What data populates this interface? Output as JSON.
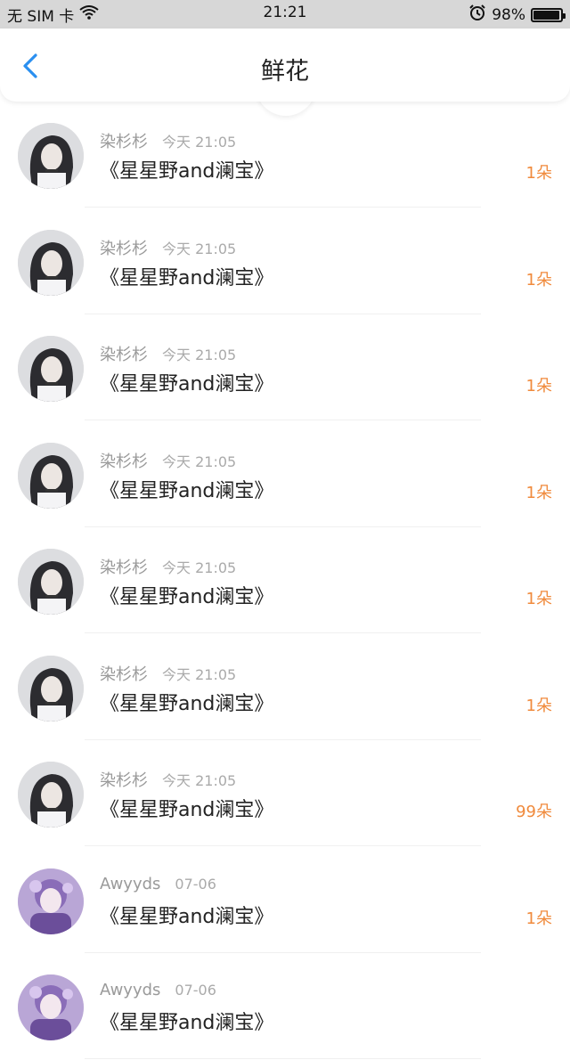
{
  "status_bar": {
    "carrier": "无 SIM 卡",
    "time": "21:21",
    "battery": "98%",
    "battery_level": 0.98
  },
  "header": {
    "title": "鲜花"
  },
  "colors": {
    "accent_blue": "#2a8ff0",
    "count_orange": "#f08a3c"
  },
  "items": [
    {
      "user": "染杉杉",
      "date": "今天 21:05",
      "title": "《星星野and澜宝》",
      "count": "1朵"
    },
    {
      "user": "染杉杉",
      "date": "今天 21:05",
      "title": "《星星野and澜宝》",
      "count": "1朵"
    },
    {
      "user": "染杉杉",
      "date": "今天 21:05",
      "title": "《星星野and澜宝》",
      "count": "1朵"
    },
    {
      "user": "染杉杉",
      "date": "今天 21:05",
      "title": "《星星野and澜宝》",
      "count": "1朵"
    },
    {
      "user": "染杉杉",
      "date": "今天 21:05",
      "title": "《星星野and澜宝》",
      "count": "1朵"
    },
    {
      "user": "染杉杉",
      "date": "今天 21:05",
      "title": "《星星野and澜宝》",
      "count": "1朵"
    },
    {
      "user": "染杉杉",
      "date": "今天 21:05",
      "title": "《星星野and澜宝》",
      "count": "99朵"
    },
    {
      "user": "Awyyds",
      "date": "07-06",
      "title": "《星星野and澜宝》",
      "count": "1朵"
    },
    {
      "user": "Awyyds",
      "date": "07-06",
      "title": "《星星野and澜宝》",
      "count": ""
    }
  ]
}
